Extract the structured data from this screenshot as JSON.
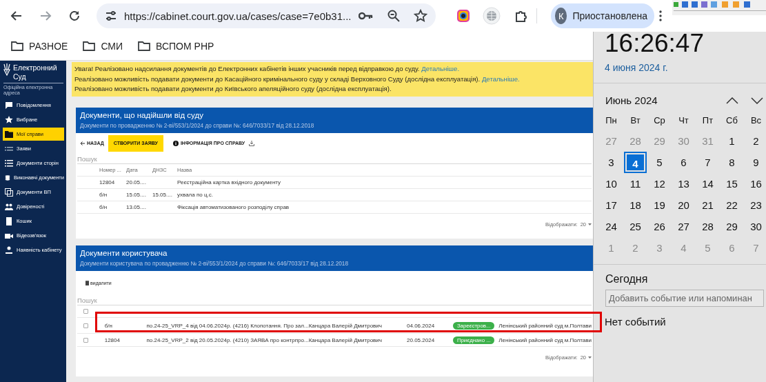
{
  "browser": {
    "url": "https://cabinet.court.gov.ua/cases/case=7e0b31...",
    "profile": {
      "initial": "К",
      "label": "Приостановлена"
    }
  },
  "bookmarks": [
    {
      "label": "РАЗНОЕ"
    },
    {
      "label": "СМИ"
    },
    {
      "label": "ВСПОМ PHP"
    }
  ],
  "sidebar": {
    "logo_lines": [
      "Електронний",
      "Суд"
    ],
    "logo_subtitle": "Офіційна електронна адреса",
    "items": [
      {
        "label": "Повідомлення",
        "selected": false
      },
      {
        "label": "Вибране",
        "selected": false
      },
      {
        "label": "Мої справи",
        "selected": true
      },
      {
        "label": "Заяви",
        "selected": false
      },
      {
        "label": "Документи сторін",
        "selected": false
      },
      {
        "label": "Виконавчі документи",
        "selected": false
      },
      {
        "label": "Документи ВП",
        "selected": false
      },
      {
        "label": "Довіреності",
        "selected": false
      },
      {
        "label": "Кошик",
        "selected": false
      },
      {
        "label": "Відеозв'язок",
        "selected": false
      },
      {
        "label": "Наявність кабінету",
        "selected": false
      }
    ]
  },
  "notice": {
    "lines": [
      {
        "text": "Увага! Реалізовано надсилання документів до Електронних кабінетів інших учасників перед відправкою до суду.",
        "link": "Детальніше."
      },
      {
        "text": "Реалізовано можливість подавати документи до Касаційного кримінального суду у складі Верховного Суду (дослідна експлуатація).",
        "link": "Детальніше."
      },
      {
        "text": "Реалізовано можливість подавати документи до Київського апеляційного суду (дослідна експлуатація)."
      }
    ]
  },
  "court_documents": {
    "title": "Документи, що надійшли від суду",
    "subtitle": "Документи по провадженню № 2-ві/553/1/2024 до справи №: 646/7033/17 від 28.12.2018",
    "back": "НАЗАД",
    "create": "СТВОРИТИ ЗАЯВУ",
    "info": "ІНФОРМАЦІЯ ПРО СПРАВУ",
    "search": {
      "placeholder": "Пошук"
    },
    "columns": [
      "Номер ...",
      "Дата",
      "ДНЗС",
      "Назва"
    ],
    "rows": [
      {
        "number": "12804",
        "date": "20.05....",
        "name": "Реєстраційна картка вхідного документу"
      },
      {
        "number": "б/н",
        "date": "15.05....",
        "dnzs": "15.05....",
        "name": "ухвала по ц.с."
      },
      {
        "number": "б/н",
        "date": "13.05....",
        "name": "Фіксація автоматизованого розподілу справ"
      }
    ],
    "page_size": {
      "label": "Відображати:",
      "value": "20"
    }
  },
  "user_documents": {
    "title": "Документи користувача",
    "subtitle": "Документи користувача по провадженню № 2-ві/553/1/2024 до справи №: 646/7033/17 від 28.12.2018",
    "delete": "видалити",
    "search": {
      "placeholder": "Пошук"
    },
    "select_all": {
      "checked": false
    },
    "rows": [
      {
        "checked": false,
        "highlighted": true,
        "number": "б/н",
        "name": "по.24-25_VRP_4 від 04.06.2024р. (4216) Клопотання. Про зал...",
        "sender": "Канцара Валерій Дмитрович",
        "date": "04.06.2024",
        "status": "Зареєстров...",
        "court": "Ленінський районний суд м.Полтави"
      },
      {
        "checked": false,
        "highlighted": false,
        "number": "12804",
        "name": "по.24-25_VRP_2 від 20.05.2024р. (4210) ЗАЯВА про контрпро...",
        "sender": "Канцара Валерій Дмитрович",
        "date": "20.05.2024",
        "status": "Приєднано ...",
        "court": "Ленінський районний суд м.Полтави"
      }
    ],
    "page_size": {
      "label": "Відображати:",
      "value": "20"
    }
  },
  "calendar": {
    "time": "16:26:47",
    "date": "4 июня 2024 г.",
    "month": "Июнь 2024",
    "weekdays": [
      "Пн",
      "Вт",
      "Ср",
      "Чт",
      "Пт",
      "Сб",
      "Вс"
    ],
    "weeks": [
      [
        {
          "day": "27",
          "muted": true,
          "selected": false
        },
        {
          "day": "28",
          "muted": true,
          "selected": false
        },
        {
          "day": "29",
          "muted": true,
          "selected": false
        },
        {
          "day": "30",
          "muted": true,
          "selected": false
        },
        {
          "day": "31",
          "muted": true,
          "selected": false
        },
        {
          "day": "1",
          "muted": false,
          "selected": false
        },
        {
          "day": "2",
          "muted": false,
          "selected": false
        }
      ],
      [
        {
          "day": "3",
          "muted": false,
          "selected": false
        },
        {
          "day": "4",
          "muted": false,
          "selected": true
        },
        {
          "day": "5",
          "muted": false,
          "selected": false
        },
        {
          "day": "6",
          "muted": false,
          "selected": false
        },
        {
          "day": "7",
          "muted": false,
          "selected": false
        },
        {
          "day": "8",
          "muted": false,
          "selected": false
        },
        {
          "day": "9",
          "muted": false,
          "selected": false
        }
      ],
      [
        {
          "day": "10",
          "muted": false,
          "selected": false
        },
        {
          "day": "11",
          "muted": false,
          "selected": false
        },
        {
          "day": "12",
          "muted": false,
          "selected": false
        },
        {
          "day": "13",
          "muted": false,
          "selected": false
        },
        {
          "day": "14",
          "muted": false,
          "selected": false
        },
        {
          "day": "15",
          "muted": false,
          "selected": false
        },
        {
          "day": "16",
          "muted": false,
          "selected": false
        }
      ],
      [
        {
          "day": "17",
          "muted": false,
          "selected": false
        },
        {
          "day": "18",
          "muted": false,
          "selected": false
        },
        {
          "day": "19",
          "muted": false,
          "selected": false
        },
        {
          "day": "20",
          "muted": false,
          "selected": false
        },
        {
          "day": "21",
          "muted": false,
          "selected": false
        },
        {
          "day": "22",
          "muted": false,
          "selected": false
        },
        {
          "day": "23",
          "muted": false,
          "selected": false
        }
      ],
      [
        {
          "day": "24",
          "muted": false,
          "selected": false
        },
        {
          "day": "25",
          "muted": false,
          "selected": false
        },
        {
          "day": "26",
          "muted": false,
          "selected": false
        },
        {
          "day": "27",
          "muted": false,
          "selected": false
        },
        {
          "day": "28",
          "muted": false,
          "selected": false
        },
        {
          "day": "29",
          "muted": false,
          "selected": false
        },
        {
          "day": "30",
          "muted": false,
          "selected": false
        }
      ],
      [
        {
          "day": "1",
          "muted": true,
          "selected": false
        },
        {
          "day": "2",
          "muted": true,
          "selected": false
        },
        {
          "day": "3",
          "muted": true,
          "selected": false
        },
        {
          "day": "4",
          "muted": true,
          "selected": false
        },
        {
          "day": "5",
          "muted": true,
          "selected": false
        },
        {
          "day": "6",
          "muted": true,
          "selected": false
        },
        {
          "day": "7",
          "muted": true,
          "selected": false
        }
      ]
    ],
    "today_label": "Сегодня",
    "event_placeholder": "Добавить событие или напоминан",
    "empty": "Нет событий"
  }
}
